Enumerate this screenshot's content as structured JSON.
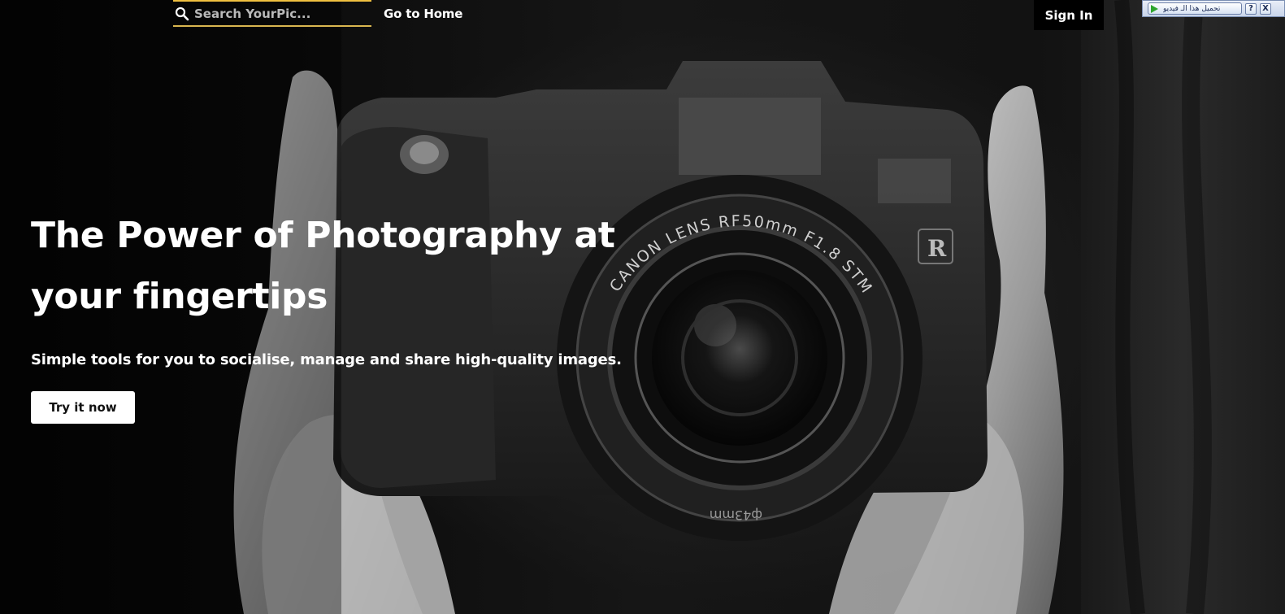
{
  "navbar": {
    "search_placeholder": "Search YourPic...",
    "home_link": "Go to Home",
    "signin_label": "Sign In",
    "accent_color": "#f0c040"
  },
  "hero": {
    "title": "The Power of Photography at your fingertips",
    "subtitle": "Simple tools for you to socialise, manage and share high-quality images.",
    "cta_label": "Try it now",
    "background_image": "black-and-white hands holding camera",
    "lens_text": "CANON LENS RF50mm F1.8 STM",
    "lens_ring_text": "ф43mm",
    "badge_letter": "R"
  },
  "browser_extension": {
    "download_label": "تحميل هذا الـ فيديو",
    "help_label": "?",
    "close_label": "X"
  }
}
